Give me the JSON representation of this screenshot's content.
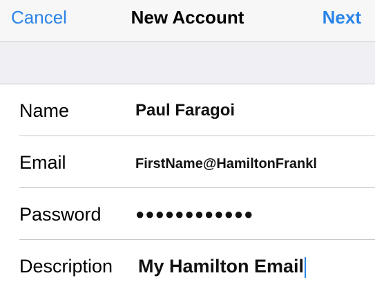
{
  "navbar": {
    "cancel_label": "Cancel",
    "title": "New Account",
    "next_label": "Next"
  },
  "form": {
    "name": {
      "label": "Name",
      "value": "Paul Faragoi"
    },
    "email": {
      "label": "Email",
      "value": "FirstName@HamiltonFrankl"
    },
    "password": {
      "label": "Password",
      "value": "●●●●●●●●●●●●"
    },
    "description": {
      "label": "Description",
      "value": "My Hamilton Email"
    }
  },
  "colors": {
    "accent": "#2a84e8",
    "nav_background": "#f7f7f8",
    "group_background": "#efeff4",
    "separator": "#c8c7cc"
  }
}
